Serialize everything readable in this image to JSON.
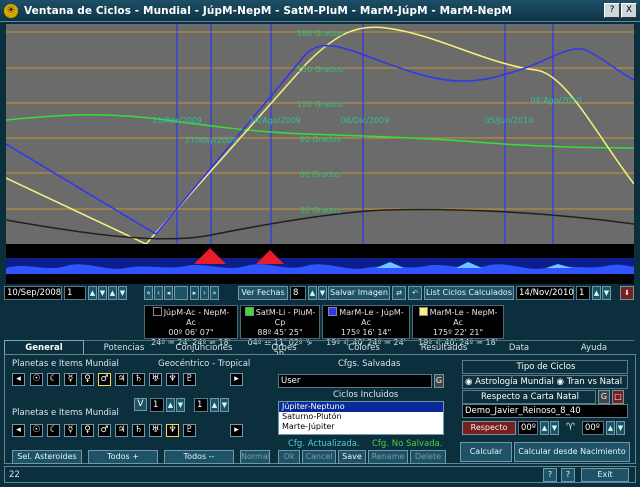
{
  "window": {
    "title": "Ventana de Ciclos - Mundial - JúpM-NepM - SatM-PluM - MarM-JúpM - MarM-NepM",
    "help_label": "?",
    "close_label": "X"
  },
  "chart_data": {
    "type": "line",
    "degree_labels": [
      "180 Grados",
      "150 Grados",
      "120 Grados",
      "90 Grados",
      "60 Grados",
      "30 Grados"
    ],
    "date_labels": [
      "11/Abr/2009",
      "27/May/2009",
      "14/Ago/2009",
      "06/Dic/2009",
      "05/Jun/2010",
      "04/Ago/2010"
    ],
    "series_colors": {
      "yellow": "#f6f27a",
      "blue": "#2f35f0",
      "green": "#33e033",
      "black": "#202020"
    }
  },
  "toolbar": {
    "start_date": "10/Sep/2008",
    "step_value": "1",
    "ver_fechas_label": "Ver Fechas",
    "ver_fechas_value": "8",
    "salvar_imagen_label": "Salvar Imagen",
    "lista_label": "List Ciclos Calculados",
    "end_date": "14/Nov/2010",
    "end_step": "1"
  },
  "legend": [
    {
      "title": "JúpM-Ac - NepM-Ac",
      "pos": "00º 06' 07\"",
      "detail": "24º ♒ 24' 24º ♒ 18'",
      "color": "#000000"
    },
    {
      "title": "SatM-Li - PluM-Cp",
      "pos": "88º 45' 25\"",
      "detail": "04º ♎ 11' 02º ♑ 56'",
      "color": "#33e033"
    },
    {
      "title": "MarM-Le - JúpM-Ac",
      "pos": "175º 16' 14\"",
      "detail": "19º ♌ 40' 24º ♒ 24'",
      "color": "#2f35f0"
    },
    {
      "title": "MarM-Le - NepM-Ac",
      "pos": "175º 22' 21\"",
      "detail": "19º ♌ 40' 24º ♒ 18'",
      "color": "#f6f27a"
    }
  ],
  "tabs": [
    "General",
    "Potencias",
    "Conjunciones",
    "Orbes",
    "Colores",
    "Resultados",
    "Data",
    "Ayuda"
  ],
  "general": {
    "planetas_label_1": "Planetas e Items Mundial",
    "geocentrico_label": "Geocéntrico - Tropical",
    "planetas_label_2": "Planetas e Items Mundial",
    "planet_glyphs": [
      "☉",
      "☾",
      "☿",
      "♀",
      "♂",
      "♃",
      "♄",
      "♅",
      "♆",
      "♇"
    ],
    "v_label": "V",
    "v_value": "1",
    "step_value": "1",
    "sel_asteroides_label": "Sel. Asteroides",
    "todos_plus_label": "Todos +",
    "todos_minus_label": "Todos --",
    "normal_label": "Normal",
    "cfgs_salvadas_label": "Cfgs. Salvadas",
    "cfgs_value": "User",
    "cfgs_button": "G",
    "ciclos_incluidos_label": "Ciclos Incluidos",
    "ciclos": [
      "Júpiter-Neptuno",
      "Saturno-Plutón",
      "Marte-Júpiter"
    ],
    "cfg_actualizada_label": "Cfg. Actualizada.",
    "cfg_no_salvada_label": "Cfg. No Salvada.",
    "ok_label": "Ok",
    "cancel_label": "Cancel",
    "save_label": "Save",
    "rename_label": "Rename",
    "delete_label": "Delete",
    "tipo_ciclos_label": "Tipo de Ciclos",
    "astrologia_mundial_label": "Astrología Mundial",
    "tran_natal_label": "Tran vs Natal",
    "respecto_carta_label": "Respecto a Carta Natal",
    "carta_button": "G",
    "carta_name": "Demo_Javier_Reinoso_8_40",
    "respecto_label": "Respecto",
    "respecto_value": "00º",
    "aries_value": "00º",
    "calcular_label": "Calcular",
    "calcular_nacimiento_label": "Calcular desde Nacimiento"
  },
  "status": {
    "count": "22",
    "exit_label": "Exit",
    "q1": "?",
    "q2": "?"
  }
}
